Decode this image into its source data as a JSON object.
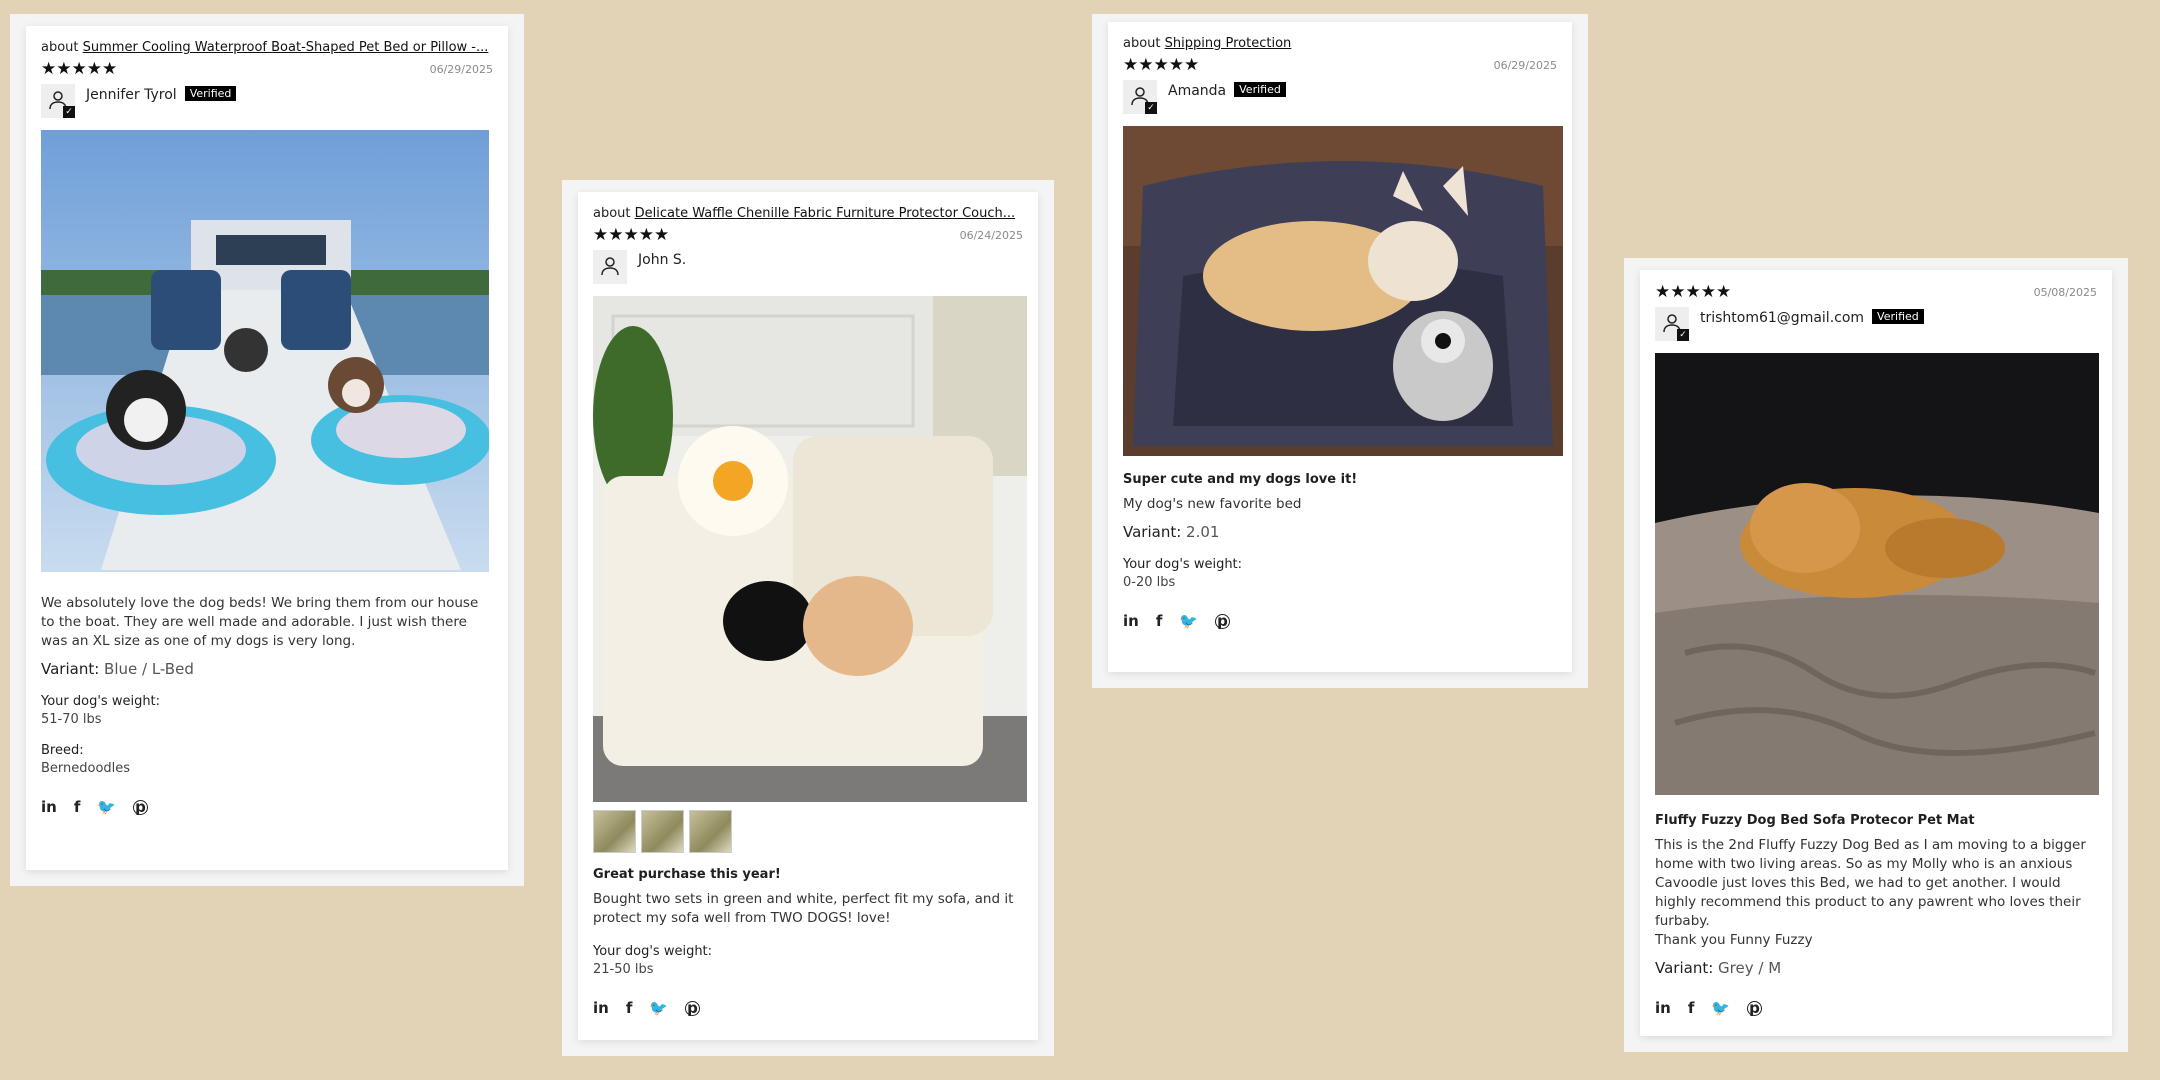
{
  "reviews": [
    {
      "about_prefix": "about",
      "about_link": "Summer Cooling Waterproof Boat-Shaped Pet Bed or Pillow -...",
      "stars": "★★★★★",
      "date": "06/29/2025",
      "name": "Jennifer Tyrol",
      "verified": "Verified",
      "body": "We absolutely love the dog beds! We bring them from our house to the boat. They are well made and adorable. I just wish there was an XL size as one of my dogs is very long.",
      "variant_label": "Variant:",
      "variant_value": "Blue / L-Bed",
      "weight_label": "Your dog's weight:",
      "weight_value": "51-70 lbs",
      "breed_label": "Breed:",
      "breed_value": "Bernedoodles"
    },
    {
      "about_prefix": "about",
      "about_link": "Delicate Waffle Chenille Fabric Furniture Protector Couch...",
      "stars": "★★★★★",
      "date": "06/24/2025",
      "name": "John S.",
      "title": "Great purchase this year!",
      "body": "Bought two sets in green and white, perfect fit my sofa, and it protect my sofa well from TWO DOGS! love!",
      "weight_label": "Your dog's weight:",
      "weight_value": "21-50 lbs"
    },
    {
      "about_prefix": "about",
      "about_link": "Shipping Protection",
      "stars": "★★★★★",
      "date": "06/29/2025",
      "name": "Amanda",
      "verified": "Verified",
      "title": "Super cute and my dogs love it!",
      "body": "My dog's new favorite bed",
      "variant_label": "Variant:",
      "variant_value": "2.01",
      "weight_label": "Your dog's weight:",
      "weight_value": "0-20 lbs"
    },
    {
      "stars": "★★★★★",
      "date": "05/08/2025",
      "name": "trishtom61@gmail.com",
      "verified": "Verified",
      "title": "Fluffy Fuzzy Dog Bed Sofa Protecor Pet Mat",
      "body": "This is the 2nd Fluffy Fuzzy Dog Bed as I am moving to a bigger home with two living areas. So as my Molly who is an anxious Cavoodle just loves this Bed, we had to get another. I would highly recommend this product to any pawrent who loves their furbaby.",
      "body2": "Thank you Funny Fuzzy",
      "variant_label": "Variant:",
      "variant_value": "Grey / M"
    }
  ],
  "social": {
    "linkedin": "in",
    "facebook": "f",
    "twitter": "🐦",
    "pinterest": "p"
  },
  "icons": {
    "avatar": "user-outline-icon",
    "check": "✓"
  },
  "colors": {
    "background": "#e2d3b6",
    "badge": "#000000"
  }
}
